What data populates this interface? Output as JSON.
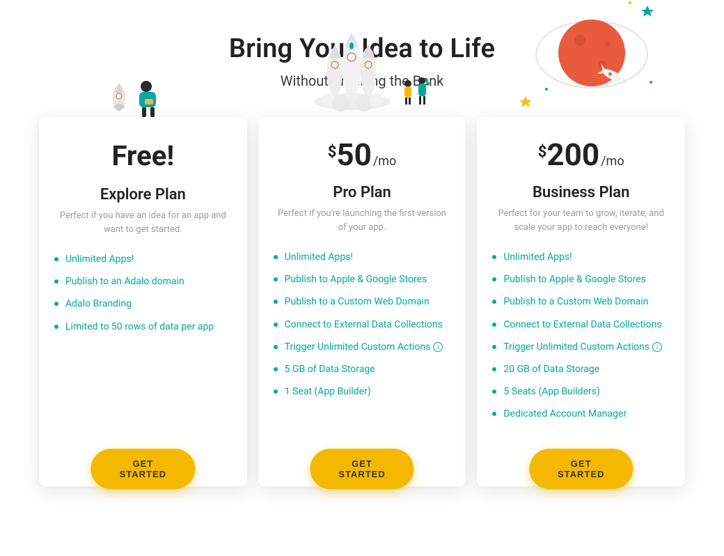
{
  "header": {
    "title": "Bring Your Idea to Life",
    "subtitle": "Without Breaking the Bank"
  },
  "plans": [
    {
      "price_label": "Free!",
      "currency": "",
      "amount": "",
      "period": "",
      "name": "Explore Plan",
      "description": "Perfect if you have an idea for an app and want to get started.",
      "features": [
        {
          "text": "Unlimited Apps!",
          "info": false
        },
        {
          "text": "Publish to an Adalo domain",
          "info": false
        },
        {
          "text": "Adalo Branding",
          "info": false
        },
        {
          "text": "Limited to 50 rows of data per app",
          "info": false
        }
      ],
      "cta": "GET STARTED"
    },
    {
      "price_label": "",
      "currency": "$",
      "amount": "50",
      "period": "/mo",
      "name": "Pro Plan",
      "description": "Perfect if you're launching the first version of your app.",
      "features": [
        {
          "text": "Unlimited Apps!",
          "info": false
        },
        {
          "text": "Publish to Apple & Google Stores",
          "info": false
        },
        {
          "text": "Publish to a Custom Web Domain",
          "info": false
        },
        {
          "text": "Connect to External Data Collections",
          "info": false
        },
        {
          "text": "Trigger Unlimited Custom Actions",
          "info": true
        },
        {
          "text": "5 GB of Data Storage",
          "info": false
        },
        {
          "text": "1 Seat (App Builder)",
          "info": false
        }
      ],
      "cta": "GET STARTED"
    },
    {
      "price_label": "",
      "currency": "$",
      "amount": "200",
      "period": "/mo",
      "name": "Business Plan",
      "description": "Perfect for your team to grow, iterate, and scale your app to reach everyone!",
      "features": [
        {
          "text": "Unlimited Apps!",
          "info": false
        },
        {
          "text": "Publish to Apple & Google Stores",
          "info": false
        },
        {
          "text": "Publish to a Custom Web Domain",
          "info": false
        },
        {
          "text": "Connect to External Data Collections",
          "info": false
        },
        {
          "text": "Trigger Unlimited Custom Actions",
          "info": true
        },
        {
          "text": "20 GB of Data Storage",
          "info": false
        },
        {
          "text": "5 Seats (App Builders)",
          "info": false
        },
        {
          "text": "Dedicated Account Manager",
          "info": false
        }
      ],
      "cta": "GET STARTED"
    }
  ]
}
